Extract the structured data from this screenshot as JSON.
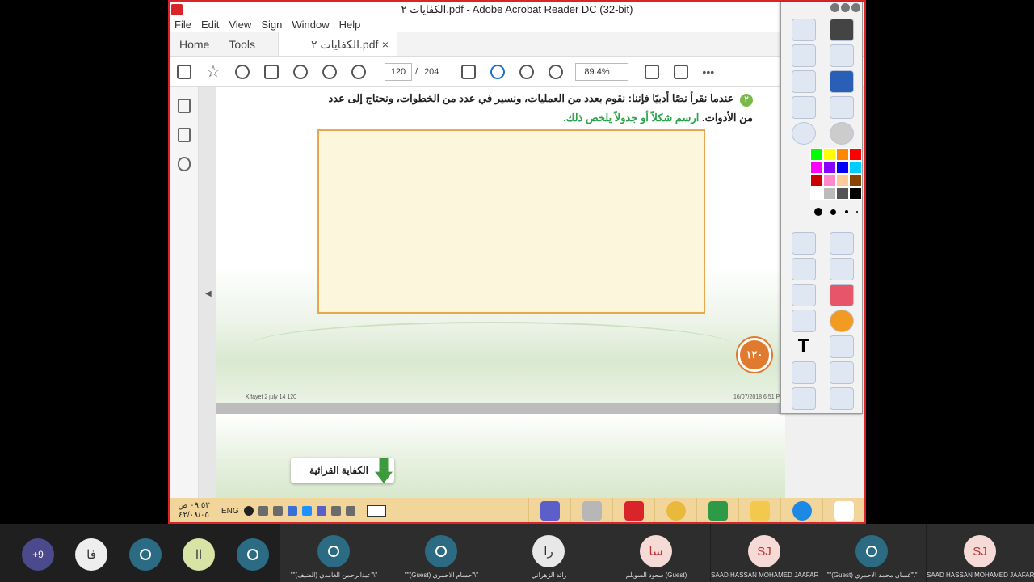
{
  "window": {
    "title": "الكفايات ٢.pdf - Adobe Acrobat Reader DC (32-bit)"
  },
  "menu": [
    "File",
    "Edit",
    "View",
    "Sign",
    "Window",
    "Help"
  ],
  "tabs": {
    "home": "Home",
    "tools": "Tools",
    "doc": "الكفايات ٢.pdf",
    "doc_close": "×"
  },
  "toolbar": {
    "page_current": "120",
    "page_sep": "/",
    "page_total": "204",
    "zoom": "89.4%",
    "more": "•••"
  },
  "document": {
    "question_number": "٢",
    "line1": "عندما نقرأ نصًا أدبيًا فإننا: نقوم بعدد من العمليات، ونسير في عدد من الخطوات، ونحتاج إلى عدد",
    "line2_a": "من الأدوات.",
    "line2_b": "ارسم شكلاً أو جدولاً يلخص ذلك.",
    "page_badge": "١٢٠",
    "footer_left": "Kifayet 2 july 14   120",
    "footer_right": "16/07/2018   6:51 P",
    "next_section": "الكفاية القرائية"
  },
  "taskbar": {
    "time": "٠٩:٥٣ ص",
    "date": "٤٢/٠٨/٠٥",
    "lang": "ENG"
  },
  "palette": [
    "#00ff00",
    "#ffff00",
    "#ff8800",
    "#ff0000",
    "#ff00ff",
    "#8800ff",
    "#0000ff",
    "#00ccff",
    "#cc0000",
    "#ff88cc",
    "#ffcc99",
    "#884400",
    "#ffffff",
    "#bbbbbb",
    "#555555",
    "#000000"
  ],
  "participants": {
    "more": "+9",
    "bubbles": [
      "فا",
      "اا"
    ],
    "tiles": [
      {
        "initials": "",
        "name": "\"\"(عبدالرحمن الغامدي (الضيف\"\\\""
      },
      {
        "initials": "",
        "name": "\"\"(Guest) حسام الاحمري\"\\\""
      },
      {
        "initials": "را",
        "name": "رائد الزهراني"
      },
      {
        "initials": "سا",
        "name": "سعود السويلم (Guest)"
      },
      {
        "initials": "SJ",
        "name": "SAAD HASSAN MOHAMED JAAFAR"
      },
      {
        "initials": "",
        "name": "\"\"(Guest) غسان محمد الاحمري\"\\\""
      },
      {
        "initials": "SJ",
        "name": "SAAD HASSAN MOHAMED JAAFAR"
      }
    ]
  }
}
